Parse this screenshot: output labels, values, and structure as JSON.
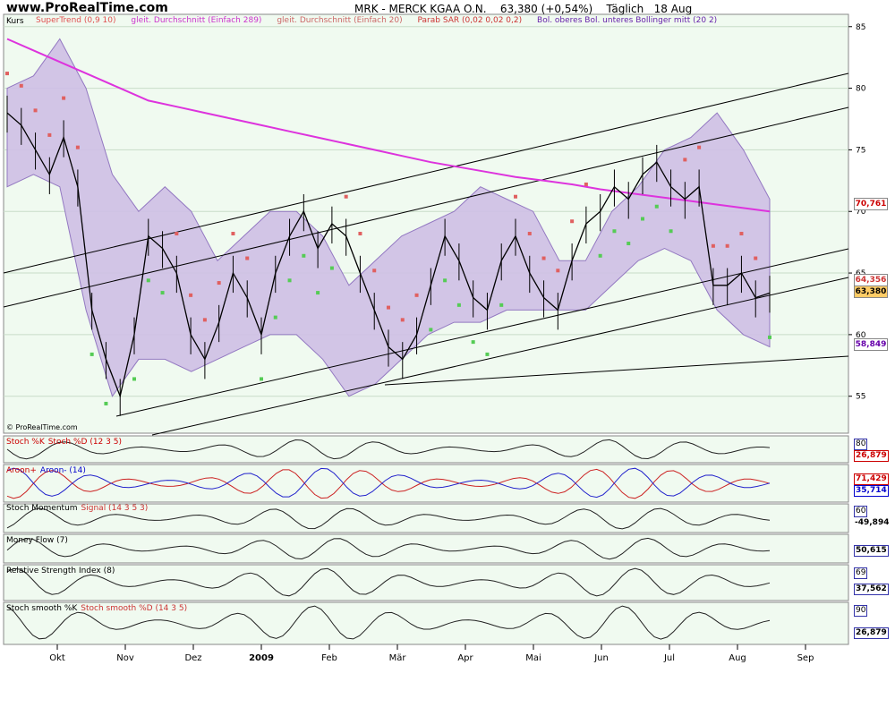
{
  "header": {
    "site": "www.ProRealTime.com",
    "ticker": "MRK - MERCK KGAA O.N.",
    "quote": "63,380 (+0,54%)",
    "period": "Täglich",
    "date": "18 Aug"
  },
  "main": {
    "label": "Kurs",
    "copyright": "© ProRealTime.com",
    "legend": [
      {
        "text": "SuperTrend (0,9 10)",
        "color": "#e05050"
      },
      {
        "text": "gleit. Durchschnitt (Einfach 289)",
        "color": "#cc33cc"
      },
      {
        "text": "gleit. Durchschnitt (Einfach 20)",
        "color": "#cc6666"
      },
      {
        "text": "Parab SAR (0,02 0,02 0,2)",
        "color": "#cc3333"
      },
      {
        "text": "Bol. oberes Bol. unteres Bollinger mitt (20 2)",
        "color": "#6622aa"
      }
    ],
    "price_labels": [
      {
        "text": "70,761",
        "color": "#cc0000",
        "bg": "#ffffff",
        "value": 70.761
      },
      {
        "text": "64,356",
        "color": "#cc3333",
        "bg": "#ffffff",
        "value": 64.356
      },
      {
        "text": "63,380",
        "color": "#000000",
        "bg": "#ffcc66",
        "value": 63.38
      },
      {
        "text": "58,849",
        "color": "#6600aa",
        "bg": "#ffffff",
        "value": 58.849
      }
    ]
  },
  "panels": [
    {
      "label": "Stoch %K",
      "label2": "Stoch %D (12 3 5)",
      "boxes": [
        {
          "text": "80",
          "bold": false
        },
        {
          "text": "26,879",
          "bold": true,
          "color": "#cc0000"
        }
      ]
    },
    {
      "label": "Aroon+",
      "label2": "Aroon- (14)",
      "boxes": [
        {
          "text": "71,429",
          "bold": true,
          "color": "#cc0000"
        },
        {
          "text": "35,714",
          "bold": true,
          "color": "#0000cc"
        }
      ]
    },
    {
      "label": "Stoch Momentum",
      "label2": "Signal (14 3 5 3)",
      "boxes": [
        {
          "text": "60",
          "bold": false
        },
        {
          "text": "-49,894",
          "bold": true,
          "color": "#000000"
        }
      ]
    },
    {
      "label": "Money Flow (7)",
      "label2": "",
      "boxes": [
        {
          "text": "50,615",
          "bold": true,
          "color": "#000000"
        }
      ]
    },
    {
      "label": "Relative Strength Index (8)",
      "label2": "",
      "boxes": [
        {
          "text": "69",
          "bold": false
        },
        {
          "text": "37,562",
          "bold": true,
          "color": "#000000"
        }
      ]
    },
    {
      "label": "Stoch smooth %K",
      "label2": "Stoch smooth %D (14 3 5)",
      "boxes": [
        {
          "text": "90",
          "bold": false
        },
        {
          "text": "26,879",
          "bold": true,
          "color": "#000000"
        }
      ]
    }
  ],
  "chart_data": {
    "type": "line",
    "title": "MRK - MERCK KGAA O.N.",
    "x_ticks": [
      "Okt",
      "Nov",
      "Dez",
      "2009",
      "Feb",
      "Mär",
      "Apr",
      "Mai",
      "Jun",
      "Jul",
      "Aug",
      "Sep"
    ],
    "y_ticks": [
      55,
      60,
      65,
      70,
      75,
      80,
      85
    ],
    "ylim": [
      52,
      86
    ],
    "series": [
      {
        "name": "Kurs",
        "values": [
          78,
          77,
          75,
          73,
          76,
          72,
          62,
          58,
          55,
          60,
          68,
          67,
          65,
          60,
          58,
          61,
          65,
          63,
          60,
          65,
          68,
          70,
          67,
          69,
          68,
          65,
          62,
          59,
          58,
          60,
          64,
          68,
          66,
          63,
          62,
          66,
          68,
          65,
          63,
          62,
          66,
          69,
          70,
          72,
          71,
          73,
          74,
          72,
          71,
          72,
          64,
          64,
          65,
          63,
          63.38
        ]
      },
      {
        "name": "gleit. Durchschnitt (Einfach 289)",
        "values": [
          84,
          83,
          82,
          81,
          80,
          79,
          78.5,
          78,
          77.5,
          77,
          76.5,
          76,
          75.5,
          75,
          74.5,
          74,
          73.6,
          73.2,
          72.8,
          72.5,
          72.2,
          71.8,
          71.5,
          71.2,
          70.9,
          70.6,
          70.3,
          70
        ]
      },
      {
        "name": "Bol. oberes",
        "values": [
          80,
          81,
          84,
          80,
          73,
          70,
          72,
          70,
          66,
          68,
          70,
          70,
          68,
          64,
          66,
          68,
          69,
          70,
          72,
          71,
          70,
          66,
          66,
          70,
          72,
          75,
          76,
          78,
          75,
          71
        ]
      },
      {
        "name": "Bol. unteres",
        "values": [
          72,
          73,
          72,
          62,
          55,
          58,
          58,
          57,
          58,
          59,
          60,
          60,
          58,
          55,
          56,
          58,
          60,
          61,
          61,
          62,
          62,
          62,
          62,
          64,
          66,
          67,
          66,
          62,
          60,
          59
        ]
      }
    ]
  }
}
